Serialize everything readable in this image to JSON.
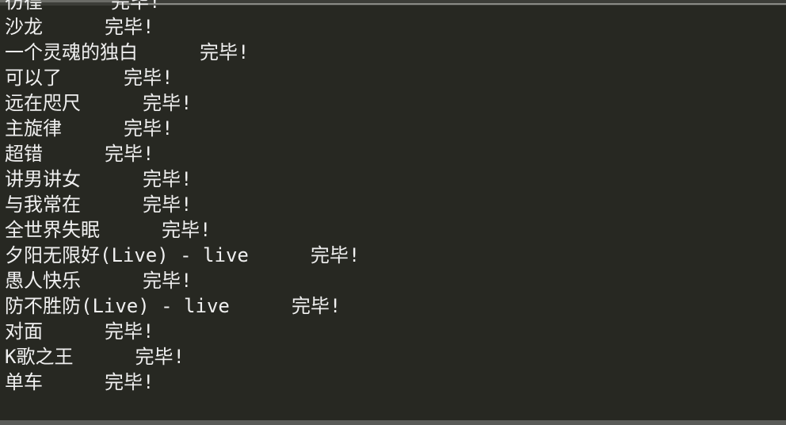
{
  "output": {
    "lines": [
      {
        "song": "彷徨",
        "gap": 120,
        "status": "完毕!"
      },
      {
        "song": "沙龙",
        "gap": 78,
        "status": "完毕!"
      },
      {
        "song": "一个灵魂的独白",
        "gap": 78,
        "status": "完毕!"
      },
      {
        "song": "可以了",
        "gap": 78,
        "status": "完毕!"
      },
      {
        "song": "远在咫尺",
        "gap": 78,
        "status": "完毕!"
      },
      {
        "song": "主旋律",
        "gap": 78,
        "status": "完毕!"
      },
      {
        "song": "超错",
        "gap": 78,
        "status": "完毕!"
      },
      {
        "song": "讲男讲女",
        "gap": 78,
        "status": "完毕!"
      },
      {
        "song": "与我常在",
        "gap": 78,
        "status": "完毕!"
      },
      {
        "song": "全世界失眠",
        "gap": 78,
        "status": "完毕!"
      },
      {
        "song": "夕阳无限好(Live) - live",
        "gap": 78,
        "status": "完毕!"
      },
      {
        "song": "愚人快乐",
        "gap": 78,
        "status": "完毕!"
      },
      {
        "song": "防不胜防(Live) - live",
        "gap": 78,
        "status": "完毕!"
      },
      {
        "song": "对面",
        "gap": 78,
        "status": "完毕!"
      },
      {
        "song": "K歌之王",
        "gap": 78,
        "status": "完毕!"
      },
      {
        "song": "单车",
        "gap": 78,
        "status": "完毕!"
      }
    ]
  },
  "colors": {
    "background": "#272822",
    "text": "#f0f0f0"
  }
}
